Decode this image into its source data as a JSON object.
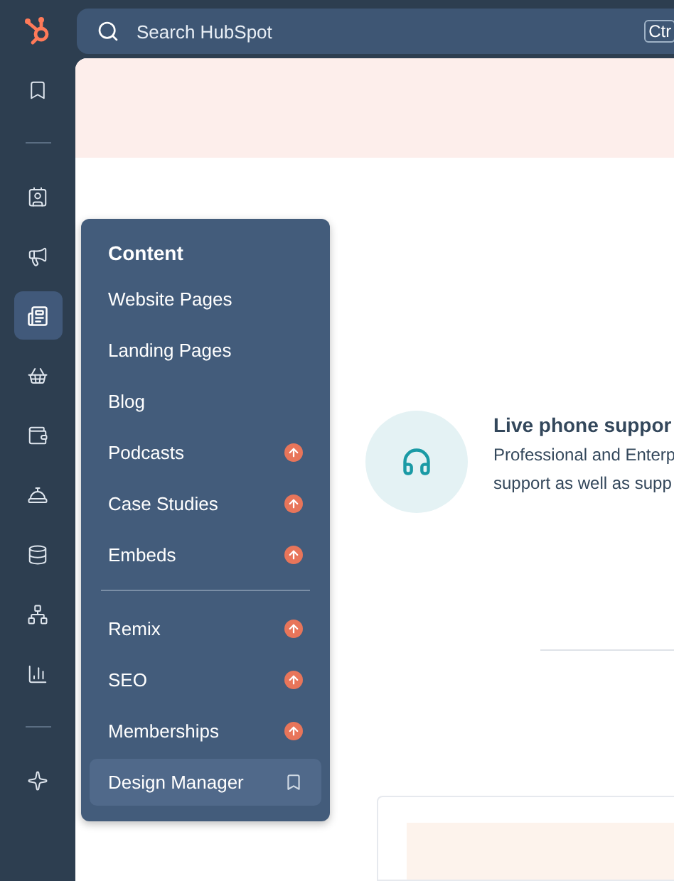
{
  "rail": [
    {
      "kind": "button",
      "selected": false
    },
    {
      "kind": "divider"
    },
    {
      "kind": "button",
      "selected": false
    },
    {
      "kind": "button",
      "selected": false
    },
    {
      "kind": "button",
      "selected": true
    },
    {
      "kind": "button",
      "selected": false
    },
    {
      "kind": "button",
      "selected": false
    },
    {
      "kind": "button",
      "selected": false
    },
    {
      "kind": "button",
      "selected": false
    },
    {
      "kind": "button",
      "selected": false
    },
    {
      "kind": "button",
      "selected": false
    },
    {
      "kind": "divider"
    },
    {
      "kind": "button",
      "selected": false
    }
  ],
  "search": {
    "placeholder": "Search HubSpot",
    "shortcut": "Ctr"
  },
  "menu": {
    "title": "Content",
    "sections": [
      [
        {
          "label": "Website Pages",
          "kind": "plain",
          "selected": false
        },
        {
          "label": "Landing Pages",
          "kind": "plain",
          "selected": false
        },
        {
          "label": "Blog",
          "kind": "plain",
          "selected": false
        },
        {
          "label": "Podcasts",
          "kind": "upgrade",
          "selected": false
        },
        {
          "label": "Case Studies",
          "kind": "upgrade",
          "selected": false
        },
        {
          "label": "Embeds",
          "kind": "upgrade",
          "selected": false
        }
      ],
      [
        {
          "label": "Remix",
          "kind": "upgrade",
          "selected": false
        },
        {
          "label": "SEO",
          "kind": "upgrade",
          "selected": false
        },
        {
          "label": "Memberships",
          "kind": "upgrade",
          "selected": false
        },
        {
          "label": "Design Manager",
          "kind": "bookmark",
          "selected": true
        }
      ]
    ]
  },
  "feature": {
    "title": "Live phone suppor",
    "lines": [
      "Professional and Enterp",
      "support as well as supp"
    ]
  }
}
